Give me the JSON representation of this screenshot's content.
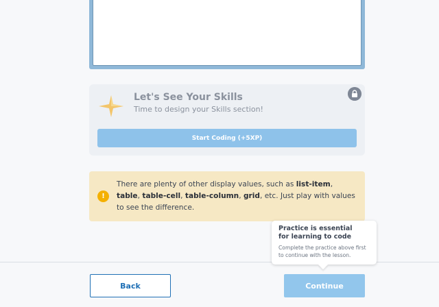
{
  "lesson_card": {
    "title": "Let's See Your Skills",
    "subtitle": "Time to design your Skills section!",
    "start_label": "Start Coding (+5XP)",
    "icon_star": "star-icon",
    "icon_lock": "lock-icon"
  },
  "note": {
    "icon": "warning-icon",
    "text_before": "There are plenty of other display values, such as ",
    "term1": "list-item",
    "sep1": ", ",
    "term2": "table",
    "sep2": ", ",
    "term3": "table-cell",
    "sep3": ", ",
    "term4": "table-column",
    "sep4": ", ",
    "term5": "grid",
    "text_after": ", etc. Just play with values to see the difference."
  },
  "tooltip": {
    "title": "Practice is essential for learning to code",
    "body": "Complete the practice above first to continue with the lesson."
  },
  "footer": {
    "back_label": "Back",
    "continue_label": "Continue"
  },
  "colors": {
    "accent": "#1e6fb5",
    "disabled_blue": "#92c6ec",
    "note_bg": "#f6e8c4",
    "warning": "#f4b000"
  }
}
